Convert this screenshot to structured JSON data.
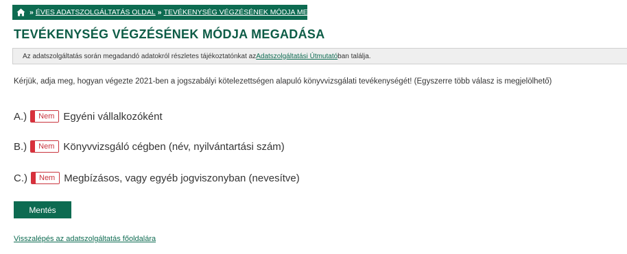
{
  "breadcrumb": {
    "home_icon": "home-icon",
    "separator": "»",
    "items": [
      {
        "label": "ÉVES ADATSZOLGÁLTATÁS OLDAL"
      },
      {
        "label": "TEVÉKENYSÉG VÉGZÉSÉNEK MÓDJA MEGADÁSA"
      }
    ]
  },
  "page_title": "TEVÉKENYSÉG VÉGZÉSÉNEK MÓDJA MEGADÁSA",
  "info": {
    "prefix": "Az adatszolgáltatás során megadandó adatokról részletes tájékoztatónkat az ",
    "link": "Adatszolgáltatási Útmutató",
    "suffix": "ban találja."
  },
  "question": "Kérjük, adja meg, hogyan végezte 2021-ben a jogszabályi kötelezettségen alapuló könyvvizsgálati tevékenységét! (Egyszerre több válasz is megjelölhető)",
  "options": [
    {
      "letter": "A.)",
      "toggle": "Nem",
      "text": "Egyéni vállalkozóként"
    },
    {
      "letter": "B.)",
      "toggle": "Nem",
      "text": "Könyvvizsgáló cégben (név, nyilvántartási szám)"
    },
    {
      "letter": "C.)",
      "toggle": "Nem",
      "text": "Megbízásos, vagy egyéb jogviszonyban (nevesítve)"
    }
  ],
  "save_label": "Mentés",
  "back_link": "Visszalépés az adatszolgáltatás főoldalára",
  "colors": {
    "primary": "#0d6b51",
    "title": "#0d5c46",
    "toggle_off": "#d9303b"
  }
}
